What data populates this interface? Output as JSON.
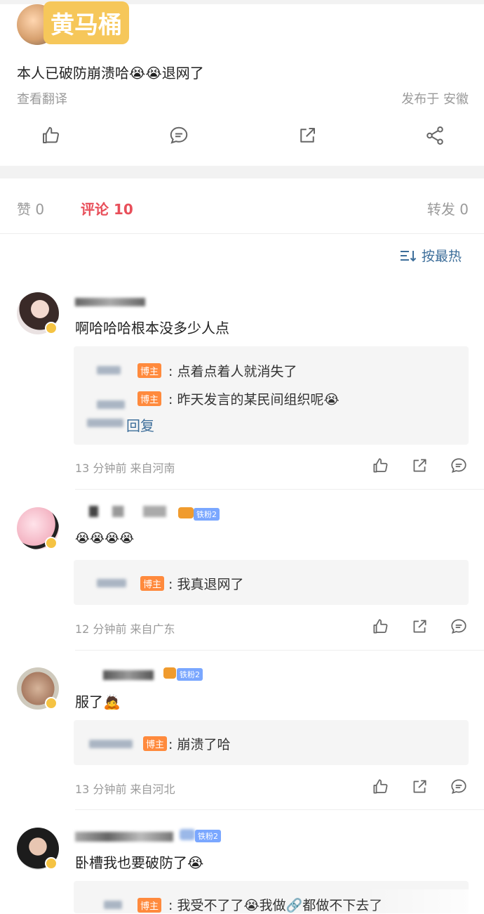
{
  "post": {
    "stamp_text": "黄马桶",
    "body_text": "本人已破防崩溃哈😭😭退网了",
    "translate_label": "查看翻译",
    "publish_meta": "发布于 安徽"
  },
  "actions": {
    "like_icon": "thumbs-up-icon",
    "comment_icon": "comment-bubble-icon",
    "repost_icon": "share-out-icon",
    "share_icon": "share-nodes-icon"
  },
  "tabs": {
    "likes": "赞 0",
    "comments": "评论 10",
    "reposts": "转发 0",
    "active_color": "#e84f5a"
  },
  "sort": {
    "label": "按最热",
    "icon": "sort-lines-icon"
  },
  "comments": [
    {
      "text": "啊哈哈哈根本没多少人点",
      "replies": [
        {
          "badge": "博主",
          "text": ": 点着点着人就消失了"
        },
        {
          "badge": "博主",
          "text": ": 昨天发言的某民间组织呢😭"
        }
      ],
      "reply_link": "回复",
      "meta": "13 分钟前  来自河南"
    },
    {
      "text": "😭😭😭😭",
      "fan_badge": "铁粉2",
      "replies": [
        {
          "badge": "博主",
          "text": ": 我真退网了"
        }
      ],
      "meta": "12 分钟前  来自广东"
    },
    {
      "text": "服了🙇",
      "fan_badge": "铁粉2",
      "replies": [
        {
          "badge": "博主",
          "text": ": 崩溃了哈"
        }
      ],
      "meta": "13 分钟前  来自河北"
    },
    {
      "text": "卧槽我也要破防了😭",
      "fan_badge": "铁粉2",
      "replies": [
        {
          "badge": "博主",
          "text": ": 我受不了了😭我做🔗都做不下去了"
        }
      ]
    }
  ]
}
